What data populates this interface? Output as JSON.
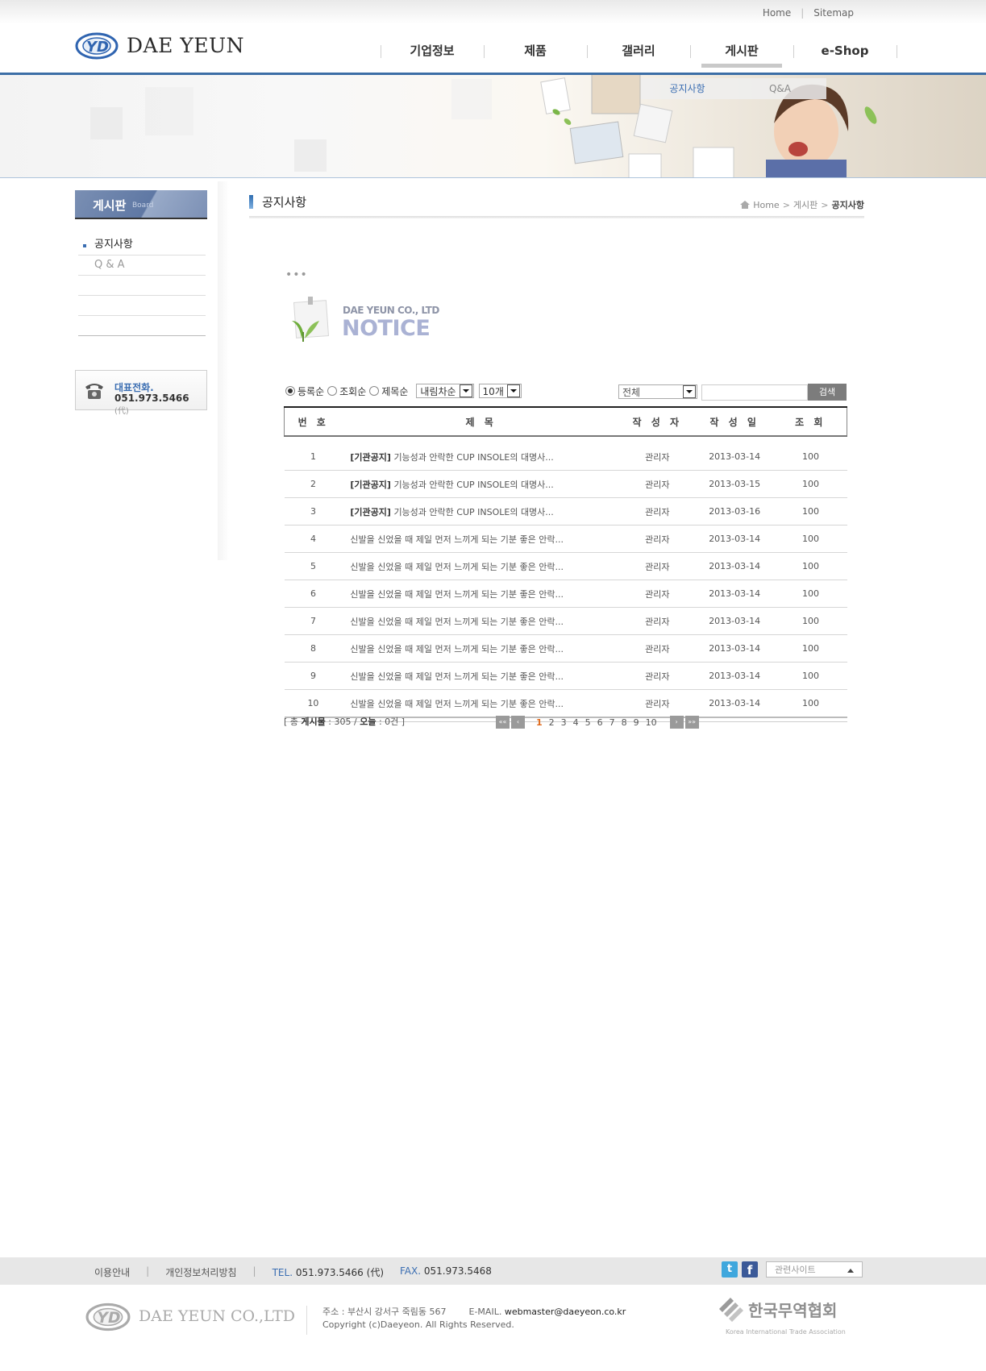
{
  "header": {
    "util_links": [
      "Home",
      "Sitemap"
    ],
    "logo_text": "DAE YEUN",
    "gnb": [
      {
        "label": "기업정보",
        "active": false
      },
      {
        "label": "제품",
        "active": false
      },
      {
        "label": "갤러리",
        "active": false
      },
      {
        "label": "게시판",
        "active": true
      },
      {
        "label": "e-Shop",
        "active": false
      }
    ],
    "subnav": [
      {
        "label": "공지사항",
        "active": true
      },
      {
        "label": "Q&A",
        "active": false
      }
    ]
  },
  "lnb": {
    "title": "게시판",
    "title_en": "Board",
    "items": [
      {
        "label": "공지사항",
        "active": true
      },
      {
        "label": "Q & A",
        "active": false
      }
    ],
    "call_label": "대표전화.",
    "call_number": "051.973.5466",
    "call_suffix": "(代)"
  },
  "content": {
    "title": "공지사항",
    "breadcrumb": [
      "Home",
      "게시판",
      "공지사항"
    ],
    "dots": "•••",
    "notice_sub": "DAE YEUN CO., LTD",
    "notice_main": "NOTICE"
  },
  "sortbar": {
    "radios": [
      {
        "label": "등록순",
        "checked": true
      },
      {
        "label": "조회순",
        "checked": false
      },
      {
        "label": "제목순",
        "checked": false
      }
    ],
    "order_select": "내림차순",
    "count_select": "10개",
    "search_field_select": "전체",
    "search_value": "",
    "search_button": "검색"
  },
  "board": {
    "columns": [
      "번 호",
      "제 목",
      "작 성 자",
      "작 성 일",
      "조 회"
    ],
    "rows": [
      {
        "no": "1",
        "tag": "[기관공지]",
        "title": "기능성과 안락한 CUP INSOLE의 대명사...",
        "author": "관리자",
        "date": "2013-03-14",
        "views": "100"
      },
      {
        "no": "2",
        "tag": "[기관공지]",
        "title": "기능성과 안락한 CUP INSOLE의 대명사...",
        "author": "관리자",
        "date": "2013-03-15",
        "views": "100"
      },
      {
        "no": "3",
        "tag": "[기관공지]",
        "title": "기능성과 안락한 CUP INSOLE의 대명사...",
        "author": "관리자",
        "date": "2013-03-16",
        "views": "100"
      },
      {
        "no": "4",
        "tag": "",
        "title": "신발을 신었을 때 제일 먼저 느끼게 되는 기분 좋은 안락...",
        "author": "관리자",
        "date": "2013-03-14",
        "views": "100"
      },
      {
        "no": "5",
        "tag": "",
        "title": "신발을 신었을 때 제일 먼저 느끼게 되는 기분 좋은 안락...",
        "author": "관리자",
        "date": "2013-03-14",
        "views": "100"
      },
      {
        "no": "6",
        "tag": "",
        "title": "신발을 신었을 때 제일 먼저 느끼게 되는 기분 좋은 안락...",
        "author": "관리자",
        "date": "2013-03-14",
        "views": "100"
      },
      {
        "no": "7",
        "tag": "",
        "title": "신발을 신었을 때 제일 먼저 느끼게 되는 기분 좋은 안락...",
        "author": "관리자",
        "date": "2013-03-14",
        "views": "100"
      },
      {
        "no": "8",
        "tag": "",
        "title": "신발을 신었을 때 제일 먼저 느끼게 되는 기분 좋은 안락...",
        "author": "관리자",
        "date": "2013-03-14",
        "views": "100"
      },
      {
        "no": "9",
        "tag": "",
        "title": "신발을 신었을 때 제일 먼저 느끼게 되는 기분 좋은 안락...",
        "author": "관리자",
        "date": "2013-03-14",
        "views": "100"
      },
      {
        "no": "10",
        "tag": "",
        "title": "신발을 신었을 때 제일 먼저 느끼게 되는 기분 좋은 안락...",
        "author": "관리자",
        "date": "2013-03-14",
        "views": "100"
      }
    ],
    "count_prefix": "[ 총",
    "count_label": "게시물",
    "count_value": ": 305 /",
    "today_label": "오늘",
    "today_value": ": 0건 ]"
  },
  "paging": {
    "first": "««",
    "prev": "‹",
    "pages": [
      "1",
      "2",
      "3",
      "4",
      "5",
      "6",
      "7",
      "8",
      "9",
      "10"
    ],
    "current": "1",
    "next": "›",
    "last": "»»"
  },
  "footer": {
    "links": [
      "이용안내",
      "개인정보처리방침"
    ],
    "tel_label": "TEL.",
    "tel": "051.973.5466 (代)",
    "fax_label": "FAX.",
    "fax": "051.973.5468",
    "family_site": "관련사이트",
    "logo_text": "DAE YEUN CO.,LTD",
    "address": "주소 : 부산시 강서구 죽림동 567",
    "email_label": "E-MAIL.",
    "email": "webmaster@daeyeon.co.kr",
    "copyright": "Copyright (c)Daeyeon. All Rights Reserved.",
    "kita_name": "한국무역협회",
    "kita_sub": "Korea International Trade Association"
  }
}
